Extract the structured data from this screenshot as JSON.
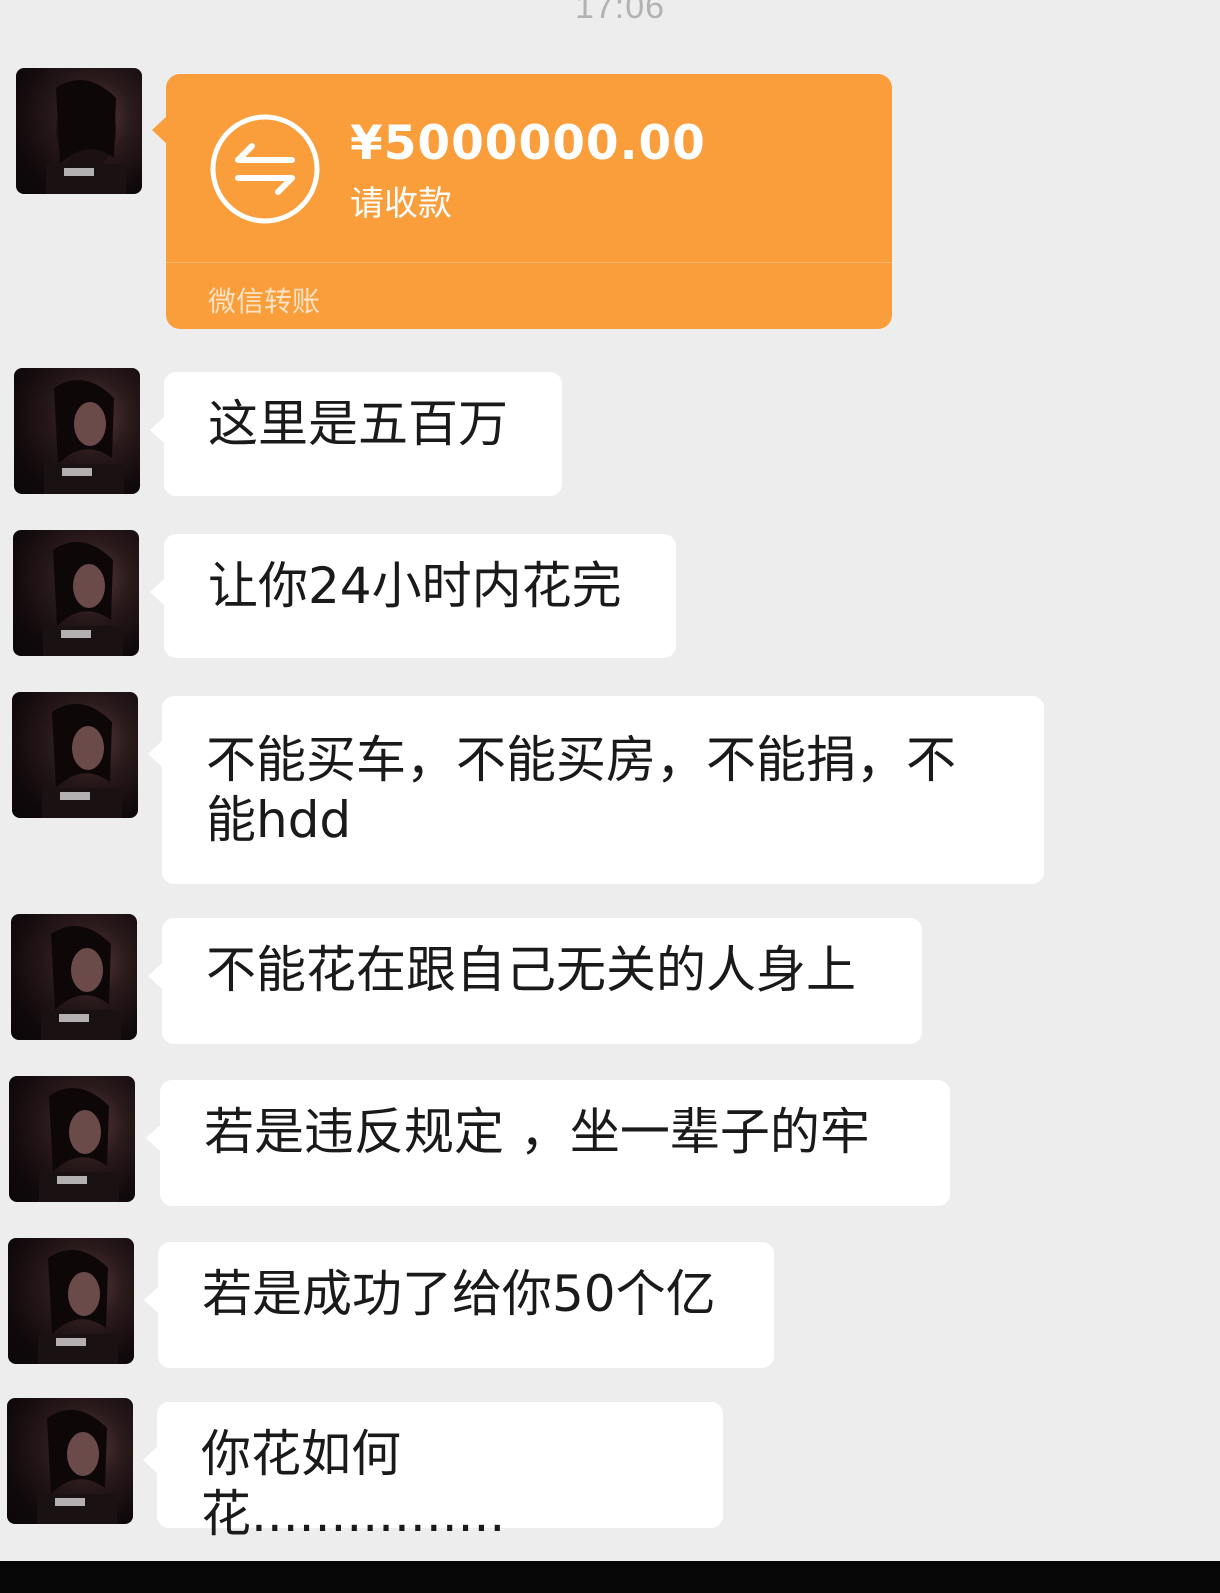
{
  "timestamp": "17:06",
  "contact": {
    "avatar_icon": "profile-photo-avatar"
  },
  "transfer": {
    "amount": "¥5000000.00",
    "note": "请收款",
    "footer": "微信转账",
    "icon": "transfer-arrows-icon",
    "color": "#fa9d3b"
  },
  "messages": [
    {
      "text": "这里是五百万"
    },
    {
      "text": "让你24小时内花完"
    },
    {
      "text": "不能买车，不能买房，不能捐，不能hdd"
    },
    {
      "text": "不能花在跟自己无关的人身上"
    },
    {
      "text": "若是违反规定 ，坐一辈子的牢"
    },
    {
      "text": "若是成功了给你50个亿"
    },
    {
      "text": "你花如何花................"
    }
  ],
  "colors": {
    "background": "#ededed",
    "bubble": "#ffffff",
    "text": "#1a1a1a"
  }
}
